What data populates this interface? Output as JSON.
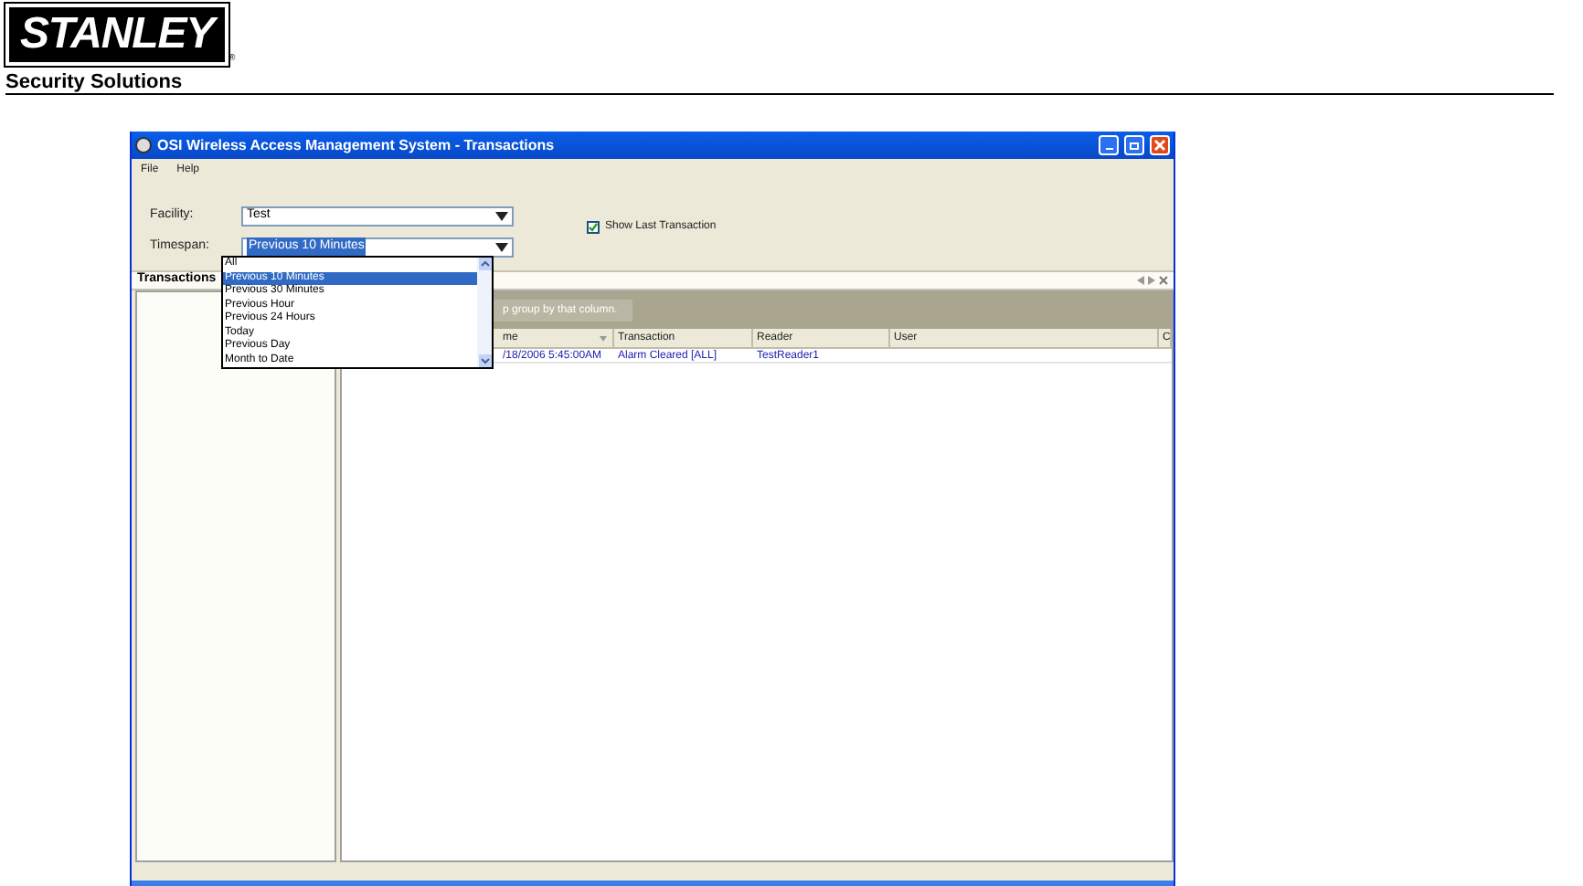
{
  "brand": {
    "logo": "STANLEY",
    "registered": "®",
    "tagline": "Security Solutions"
  },
  "window": {
    "title": "OSI Wireless Access Management System - Transactions"
  },
  "menu": [
    "File",
    "Help"
  ],
  "form": {
    "facility": {
      "label": "Facility:",
      "value": "Test"
    },
    "timespan": {
      "label": "Timespan:",
      "value": "Previous 10 Minutes",
      "expanded": true
    },
    "show_last": {
      "label": "Show Last Transaction",
      "checked": true
    }
  },
  "dropdown": [
    {
      "label": "All",
      "selected": false
    },
    {
      "label": "Previous 10 Minutes",
      "selected": true
    },
    {
      "label": "Previous 30 Minutes",
      "selected": false
    },
    {
      "label": "Previous Hour",
      "selected": false
    },
    {
      "label": "Previous 24 Hours",
      "selected": false
    },
    {
      "label": "Today",
      "selected": false
    },
    {
      "label": "Previous Day",
      "selected": false
    },
    {
      "label": "Month to Date",
      "selected": false
    }
  ],
  "panel": {
    "tab": "Transactions"
  },
  "grid": {
    "group_hint": "p group by that column.",
    "columns": [
      "me",
      "Transaction",
      "Reader",
      "User",
      "C"
    ],
    "rows": [
      [
        "/18/2006 5:45:00AM",
        "Alarm Cleared [ALL]",
        "TestReader1"
      ]
    ]
  }
}
